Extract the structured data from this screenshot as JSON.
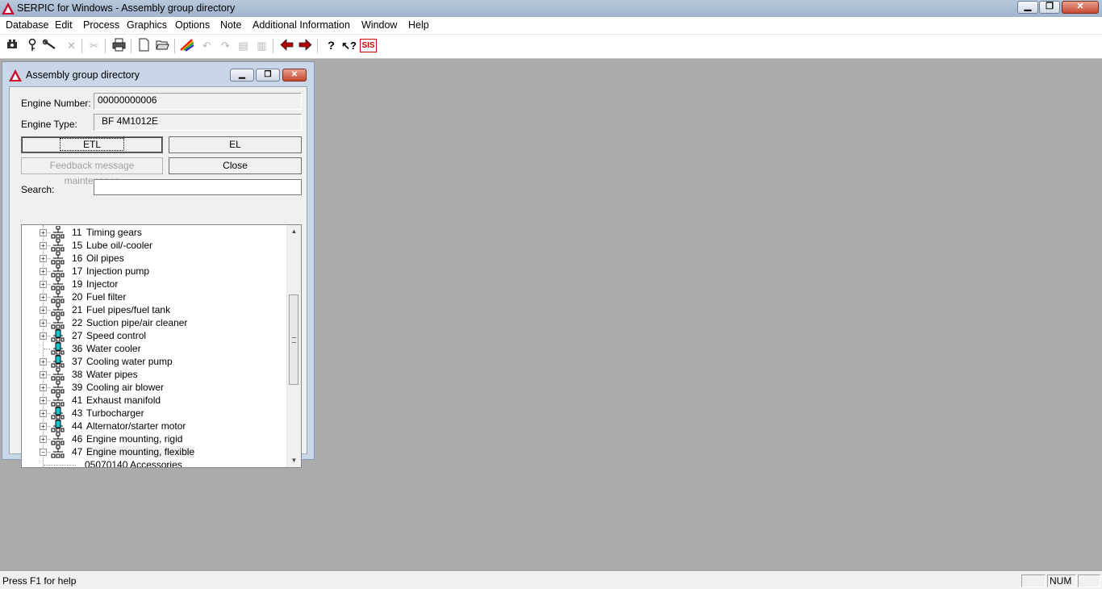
{
  "app": {
    "title": "SERPIC for Windows - Assembly group directory"
  },
  "window_controls": {
    "minimize": "▁",
    "maximize": "❐",
    "close": "✕"
  },
  "menu": [
    "Database",
    "Edit",
    "Process",
    "Graphics",
    "Options",
    "Note",
    "Additional Information",
    "Window",
    "Help"
  ],
  "toolbar_icons": [
    "engine-icon",
    "key-icon",
    "wrench-icon",
    "cross-icon",
    "scissors-icon",
    "printer-icon",
    "new-document-icon",
    "open-folder-icon",
    "rainbow-pencil-icon",
    "undo-icon",
    "redo-icon",
    "window-icon",
    "window-alt-icon",
    "arrow-left-icon",
    "arrow-right-icon",
    "help-icon",
    "context-help-icon",
    "sis-icon"
  ],
  "toolbar_sis_label": "SIS",
  "dialog": {
    "title": "Assembly group directory",
    "engine_number_label": "Engine Number:",
    "engine_number_value": "00000000006",
    "engine_type_label": "Engine Type:",
    "engine_type_value": "BF 4M1012E",
    "etl_button": "ETL",
    "el_button": "EL",
    "feedback_button": "Feedback message maintenance",
    "close_button": "Close",
    "search_label": "Search:",
    "search_value": "",
    "tree": [
      {
        "num": "11",
        "name": "Timing gears",
        "icon": "assembly-group-icon"
      },
      {
        "num": "15",
        "name": "Lube oil/-cooler",
        "icon": "assembly-group-icon"
      },
      {
        "num": "16",
        "name": "Oil pipes",
        "icon": "assembly-group-icon"
      },
      {
        "num": "17",
        "name": "Injection pump",
        "icon": "assembly-group-icon"
      },
      {
        "num": "19",
        "name": "Injector",
        "icon": "assembly-group-icon"
      },
      {
        "num": "20",
        "name": "Fuel filter",
        "icon": "assembly-group-icon"
      },
      {
        "num": "21",
        "name": "Fuel pipes/fuel tank",
        "icon": "assembly-group-icon"
      },
      {
        "num": "22",
        "name": "Suction pipe/air cleaner",
        "icon": "assembly-group-icon"
      },
      {
        "num": "27",
        "name": "Speed control",
        "icon": "assembly-group-cyan-icon"
      },
      {
        "num": "36",
        "name": "Water cooler",
        "icon": "assembly-group-cyan-icon"
      },
      {
        "num": "37",
        "name": "Cooling water pump",
        "icon": "assembly-group-cyan-icon"
      },
      {
        "num": "38",
        "name": "Water pipes",
        "icon": "assembly-group-icon"
      },
      {
        "num": "39",
        "name": "Cooling air blower",
        "icon": "assembly-group-icon"
      },
      {
        "num": "41",
        "name": "Exhaust manifold",
        "icon": "assembly-group-icon"
      },
      {
        "num": "43",
        "name": "Turbocharger",
        "icon": "assembly-group-cyan-icon"
      },
      {
        "num": "44",
        "name": "Alternator/starter motor",
        "icon": "assembly-group-cyan-icon"
      },
      {
        "num": "46",
        "name": "Engine mounting, rigid",
        "icon": "assembly-group-icon"
      },
      {
        "num": "47",
        "name": "Engine mounting, flexible",
        "icon": "assembly-group-icon"
      }
    ],
    "tree_child": "05070140  Accessories",
    "scroll_position": 0.45
  },
  "status": {
    "help_text": "Press F1 for help",
    "num": "NUM"
  },
  "colors": {
    "desktop": "#ababab",
    "cyan_group": "#19c4c8"
  }
}
